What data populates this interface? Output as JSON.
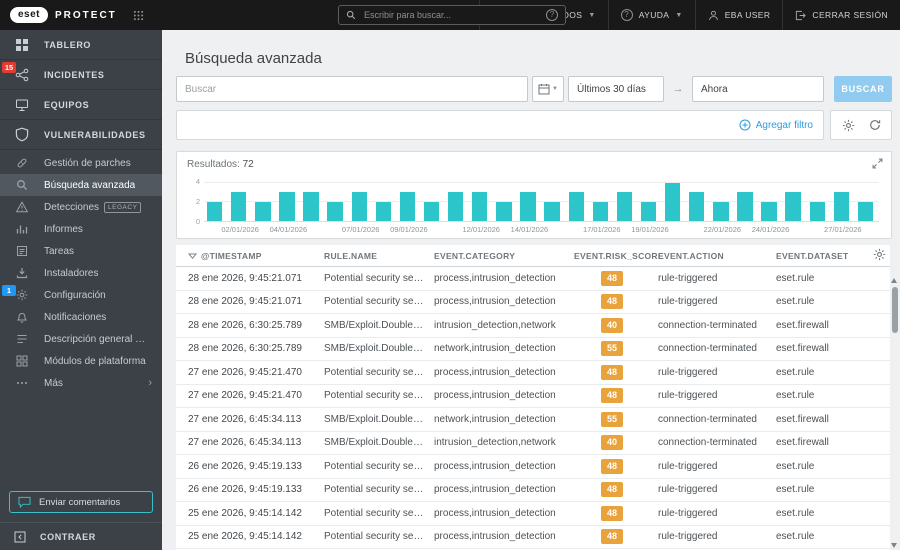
{
  "topbar": {
    "logo_text": "eset",
    "product_name": "PROTECT",
    "search_placeholder": "Escribir para buscar...",
    "search_help": "?",
    "quick_links_label": "VÍNCULOS RÁPIDOS",
    "help_label": "AYUDA",
    "user_label": "EBA USER",
    "logout_label": "CERRAR SESIÓN"
  },
  "sidebar": {
    "main_items": [
      {
        "label": "TABLERO",
        "icon": "dashboard-icon"
      },
      {
        "label": "INCIDENTES",
        "icon": "incidents-icon",
        "badge": "15",
        "badge_color": "#e23b30"
      },
      {
        "label": "EQUIPOS",
        "icon": "computers-icon"
      },
      {
        "label": "VULNERABILIDADES",
        "icon": "shield-icon"
      }
    ],
    "sub_items": [
      {
        "label": "Gestión de parches",
        "icon": "patch-management-icon"
      },
      {
        "label": "Búsqueda avanzada",
        "icon": "advanced-search-icon",
        "selected": true
      },
      {
        "label": "Detecciones",
        "icon": "detections-icon",
        "tag": "LEGACY"
      },
      {
        "label": "Informes",
        "icon": "reports-icon"
      },
      {
        "label": "Tareas",
        "icon": "tasks-icon"
      },
      {
        "label": "Instaladores",
        "icon": "installers-icon"
      },
      {
        "label": "Configuración",
        "icon": "settings-icon",
        "badge": "1",
        "badge_color": "#2196f3"
      },
      {
        "label": "Notificaciones",
        "icon": "notifications-icon"
      },
      {
        "label": "Descripción general de esta...",
        "icon": "status-overview-icon"
      },
      {
        "label": "Módulos de plataforma",
        "icon": "platform-modules-icon"
      },
      {
        "label": "Más",
        "icon": "more-icon",
        "chevron": true
      }
    ],
    "feedback_label": "Enviar comentarios",
    "collapse_label": "CONTRAER"
  },
  "page": {
    "title": "Búsqueda avanzada"
  },
  "filters": {
    "search_placeholder": "Buscar",
    "date_from": "Últimos 30 días",
    "date_to": "Ahora",
    "search_button": "BUSCAR",
    "add_filter_label": "Agregar filtro"
  },
  "results": {
    "label": "Resultados:",
    "count": "72"
  },
  "chart_data": {
    "type": "bar",
    "title": "",
    "xlabel": "",
    "ylabel": "",
    "x": [
      "01/01/2026",
      "02/01/2026",
      "03/01/2026",
      "04/01/2026",
      "05/01/2026",
      "06/01/2026",
      "07/01/2026",
      "08/01/2026",
      "09/01/2026",
      "10/01/2026",
      "11/01/2026",
      "12/01/2026",
      "13/01/2026",
      "14/01/2026",
      "15/01/2026",
      "16/01/2026",
      "17/01/2026",
      "18/01/2026",
      "19/01/2026",
      "20/01/2026",
      "21/01/2026",
      "22/01/2026",
      "23/01/2026",
      "24/01/2026",
      "25/01/2026",
      "26/01/2026",
      "27/01/2026",
      "28/01/2026"
    ],
    "values": [
      2,
      3,
      2,
      3,
      3,
      2,
      3,
      2,
      3,
      2,
      3,
      3,
      2,
      3,
      2,
      3,
      2,
      3,
      2,
      4,
      3,
      2,
      3,
      2,
      3,
      2,
      3,
      2
    ],
    "tick_labels": [
      "02/01/2026",
      "04/01/2026",
      "07/01/2026",
      "09/01/2026",
      "12/01/2026",
      "14/01/2026",
      "17/01/2026",
      "19/01/2026",
      "22/01/2026",
      "24/01/2026",
      "27/01/2026"
    ],
    "ylim": [
      0,
      4.5
    ],
    "yticks": [
      0,
      2,
      4
    ],
    "grid": true,
    "bar_color": "#2cc5c9",
    "legend": null
  },
  "table": {
    "columns": [
      {
        "key": "timestamp",
        "label": "@TIMESTAMP",
        "sort": "desc"
      },
      {
        "key": "rule_name",
        "label": "RULE.NAME"
      },
      {
        "key": "event_category",
        "label": "EVENT.CATEGORY"
      },
      {
        "key": "event_risk_score",
        "label": "EVENT.RISK_SCORE"
      },
      {
        "key": "event_action",
        "label": "EVENT.ACTION"
      },
      {
        "key": "event_dataset",
        "label": "EVENT.DATASET"
      }
    ],
    "rows": [
      {
        "timestamp": "28 ene 2026, 9:45:21.071",
        "rule_name": "Potential security service disco...",
        "event_category": "process,intrusion_detection",
        "event_risk_score": "48",
        "event_action": "rule-triggered",
        "event_dataset": "eset.rule"
      },
      {
        "timestamp": "28 ene 2026, 9:45:21.071",
        "rule_name": "Potential security service disco...",
        "event_category": "process,intrusion_detection",
        "event_risk_score": "48",
        "event_action": "rule-triggered",
        "event_dataset": "eset.rule"
      },
      {
        "timestamp": "28 ene 2026, 6:30:25.789",
        "rule_name": "SMB/Exploit.DoublePulsar.B",
        "event_category": "intrusion_detection,network",
        "event_risk_score": "40",
        "event_action": "connection-terminated",
        "event_dataset": "eset.firewall"
      },
      {
        "timestamp": "28 ene 2026, 6:30:25.789",
        "rule_name": "SMB/Exploit.DoublePulsar.B",
        "event_category": "network,intrusion_detection",
        "event_risk_score": "55",
        "event_action": "connection-terminated",
        "event_dataset": "eset.firewall"
      },
      {
        "timestamp": "27 ene 2026, 9:45:21.470",
        "rule_name": "Potential security service disco...",
        "event_category": "process,intrusion_detection",
        "event_risk_score": "48",
        "event_action": "rule-triggered",
        "event_dataset": "eset.rule"
      },
      {
        "timestamp": "27 ene 2026, 9:45:21.470",
        "rule_name": "Potential security service disco...",
        "event_category": "process,intrusion_detection",
        "event_risk_score": "48",
        "event_action": "rule-triggered",
        "event_dataset": "eset.rule"
      },
      {
        "timestamp": "27 ene 2026, 6:45:34.113",
        "rule_name": "SMB/Exploit.DoublePulsar.B",
        "event_category": "network,intrusion_detection",
        "event_risk_score": "55",
        "event_action": "connection-terminated",
        "event_dataset": "eset.firewall"
      },
      {
        "timestamp": "27 ene 2026, 6:45:34.113",
        "rule_name": "SMB/Exploit.DoublePulsar.B",
        "event_category": "intrusion_detection,network",
        "event_risk_score": "40",
        "event_action": "connection-terminated",
        "event_dataset": "eset.firewall"
      },
      {
        "timestamp": "26 ene 2026, 9:45:19.133",
        "rule_name": "Potential security service disco...",
        "event_category": "process,intrusion_detection",
        "event_risk_score": "48",
        "event_action": "rule-triggered",
        "event_dataset": "eset.rule"
      },
      {
        "timestamp": "26 ene 2026, 9:45:19.133",
        "rule_name": "Potential security service disco...",
        "event_category": "process,intrusion_detection",
        "event_risk_score": "48",
        "event_action": "rule-triggered",
        "event_dataset": "eset.rule"
      },
      {
        "timestamp": "25 ene 2026, 9:45:14.142",
        "rule_name": "Potential security service disco...",
        "event_category": "process,intrusion_detection",
        "event_risk_score": "48",
        "event_action": "rule-triggered",
        "event_dataset": "eset.rule"
      },
      {
        "timestamp": "25 ene 2026, 9:45:14.142",
        "rule_name": "Potential security service disco...",
        "event_category": "process,intrusion_detection",
        "event_risk_score": "48",
        "event_action": "rule-triggered",
        "event_dataset": "eset.rule"
      }
    ]
  },
  "colors": {
    "topbar_bg": "#191919",
    "sidebar_bg": "#3b4147",
    "selected_item_bg": "#51585f",
    "accent_teal": "#35c2c8",
    "chart_bar": "#2cc5c9",
    "search_button_bg": "#92cbf0",
    "link_blue": "#2d9cdb",
    "risk_badge": "#e8a33c",
    "incidents_badge": "#e23b30",
    "config_badge": "#2196f3"
  }
}
